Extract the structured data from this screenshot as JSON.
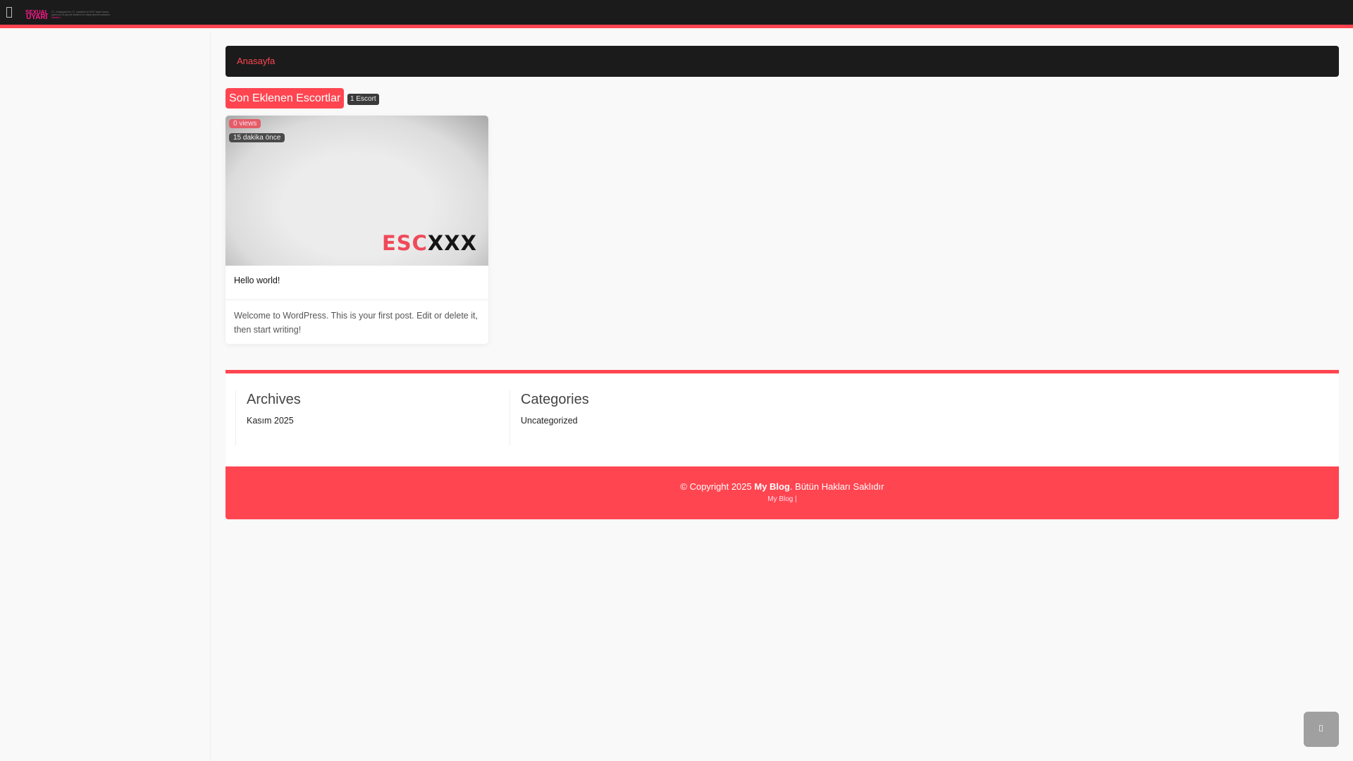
{
  "header": {
    "logo_top": "SEXUAL",
    "logo_main": "UYARI",
    "logo_text": "T.C. Anayasası'nın 17. maddesi ve 5237 sayılı kanun uyarınca 18 yaş altı kişilerin bu siteye girmesi yasaktır.",
    "logo_link": "Yasaktır !",
    "accent": "#ff4550"
  },
  "breadcrumb": {
    "home": "Anasayfa"
  },
  "section": {
    "title": "Son Eklenen Escortlar",
    "count": "1 Escort"
  },
  "posts": [
    {
      "views": "0 views",
      "time": "15 dakika önce",
      "brand_red": "ESC",
      "brand_black": "XXX",
      "title": "Hello world!",
      "excerpt": "Welcome to WordPress. This is your first post. Edit or delete it, then start writing!"
    }
  ],
  "widgets": {
    "archives": {
      "title": "Archives",
      "items": [
        "Kasım 2025"
      ]
    },
    "categories": {
      "title": "Categories",
      "items": [
        "Uncategorized"
      ]
    }
  },
  "footer": {
    "prefix": "© Copyright 2025 ",
    "site": "My Blog",
    "suffix": ". Bütün Hakları Saklıdır",
    "meta": "My Blog |"
  }
}
